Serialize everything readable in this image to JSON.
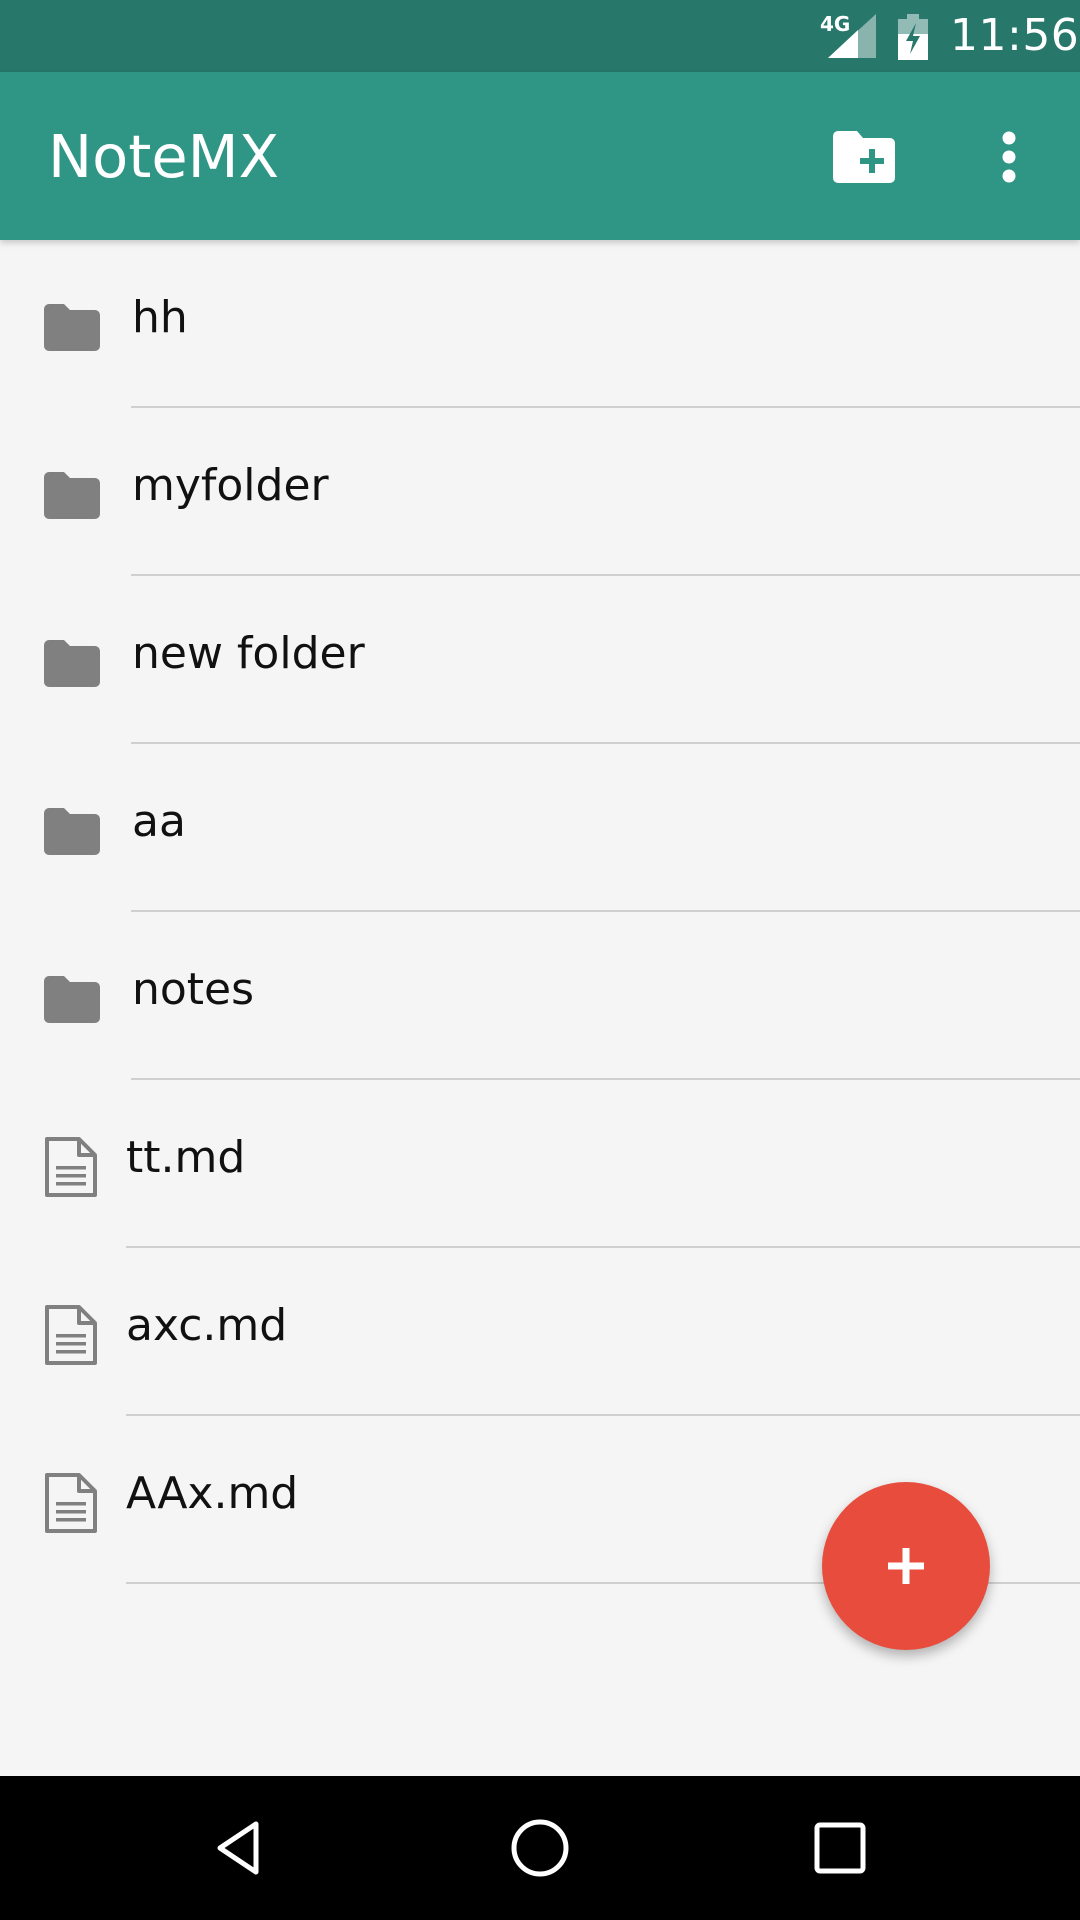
{
  "status_bar": {
    "network": "4G",
    "time": "11:56"
  },
  "app_bar": {
    "title": "NoteMX",
    "actions": [
      {
        "icon": "create-folder-icon"
      },
      {
        "icon": "more-vert-icon"
      }
    ]
  },
  "list": {
    "items": [
      {
        "type": "folder",
        "name": "hh"
      },
      {
        "type": "folder",
        "name": "myfolder"
      },
      {
        "type": "folder",
        "name": "new folder"
      },
      {
        "type": "folder",
        "name": "aa"
      },
      {
        "type": "folder",
        "name": "notes"
      },
      {
        "type": "file",
        "name": "tt.md"
      },
      {
        "type": "file",
        "name": "axc.md"
      },
      {
        "type": "file",
        "name": "AAx.md"
      }
    ]
  },
  "fab": {
    "icon": "plus-icon"
  },
  "nav_bar": {
    "buttons": [
      {
        "icon": "back-triangle-icon"
      },
      {
        "icon": "home-circle-icon"
      },
      {
        "icon": "recents-square-icon"
      }
    ]
  },
  "colors": {
    "status_bar": "#27776b",
    "app_bar": "#2f9685",
    "background": "#f5f5f5",
    "fab": "#e84c3d",
    "icon_gray": "#808080",
    "divider": "#d0d0d0"
  }
}
